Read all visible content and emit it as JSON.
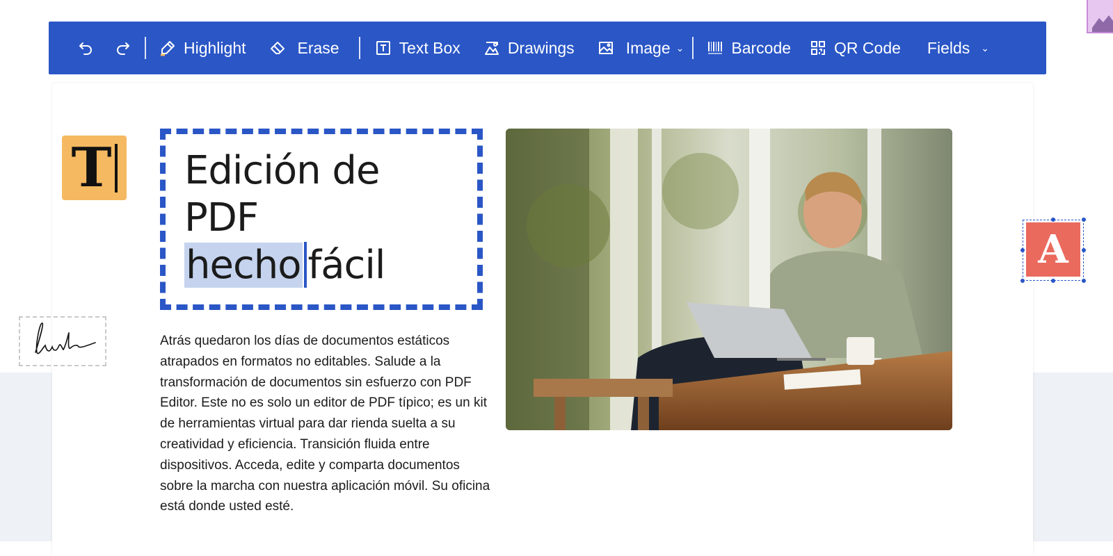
{
  "toolbar": {
    "items": [
      {
        "label": "Highlight",
        "icon": "highlighter-icon"
      },
      {
        "label": "Erase",
        "icon": "eraser-icon"
      },
      {
        "label": "Text Box",
        "icon": "text-box-icon"
      },
      {
        "label": "Drawings",
        "icon": "drawing-icon"
      },
      {
        "label": "Image",
        "icon": "image-icon"
      },
      {
        "label": "Barcode",
        "icon": "barcode-icon"
      },
      {
        "label": "QR Code",
        "icon": "qr-code-icon"
      },
      {
        "label": "Fields",
        "icon": ""
      }
    ],
    "accent_color": "#2a56c6"
  },
  "headline": {
    "line1": "Edición de",
    "line2": "PDF",
    "selected_word": "hecho",
    "line3_rest": "fácil"
  },
  "body_text": "Atrás quedaron los días de documentos estáticos atrapados en formatos no editables. Salude a la transformación de documentos sin esfuerzo con PDF Editor. Este no es solo un editor de PDF típico; es un kit de herramientas virtual para dar rienda suelta a su creatividad y eficiencia. Transición fluida entre dispositivos. Acceda, edite y comparta documentos sobre la marcha con nuestra aplicación móvil. Su oficina está donde usted esté.",
  "decor": {
    "text_tile_letter": "T",
    "annotation_tile_letter": "A",
    "text_tile_color": "#f5b961",
    "annotation_tile_color": "#ea6a5e"
  }
}
